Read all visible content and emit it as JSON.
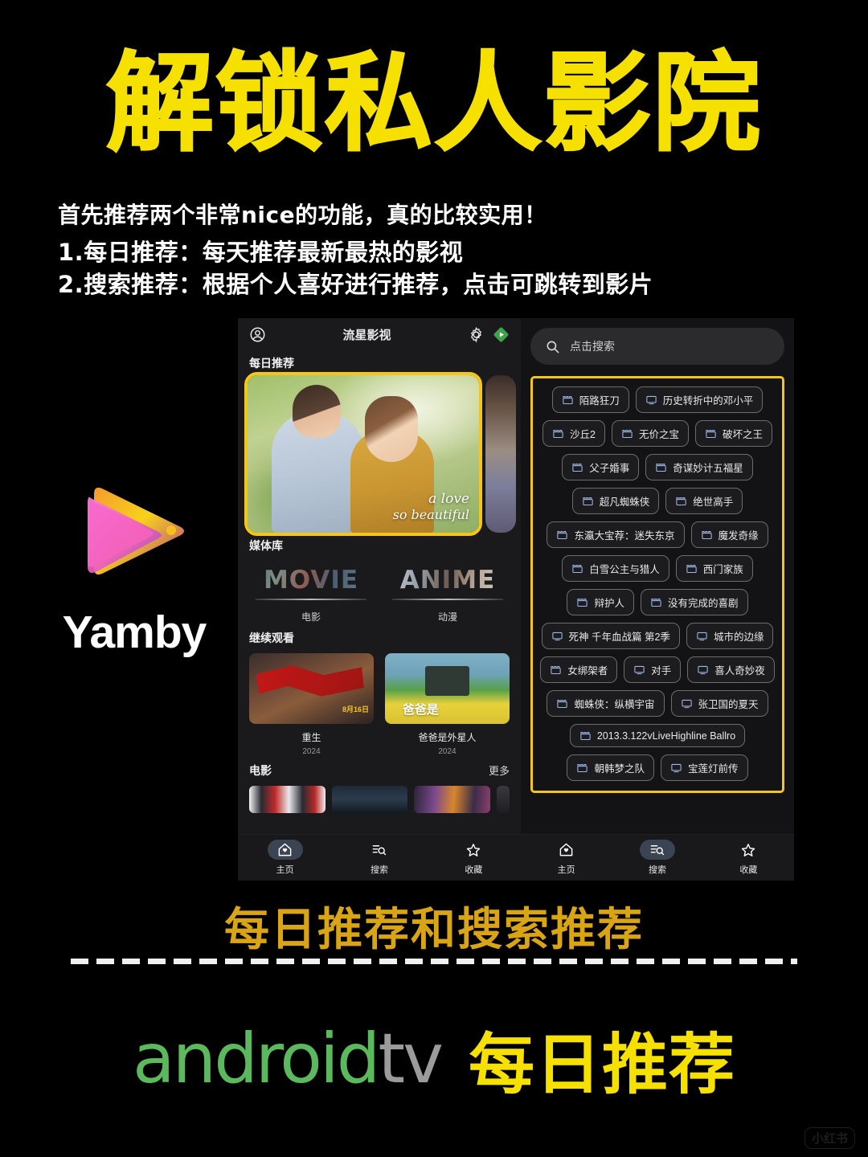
{
  "poster": {
    "headline": "解锁私人影院",
    "subtitle_lines": [
      "首先推荐两个非常nice的功能，真的比较实用！",
      "1.每日推荐：每天推荐最新最热的影视",
      "2.搜索推荐：根据个人喜好进行推荐，点击可跳转到影片"
    ],
    "caption": "每日推荐和搜索推荐",
    "watermark": "小红书",
    "accent_yellow": "#f5e000",
    "accent_gold": "#f5c518",
    "caption_gold": "#d9a514"
  },
  "brand": {
    "name": "Yamby",
    "logo_icon": "play-triangle-logo"
  },
  "footer": {
    "android_word": "android",
    "tv_word": "tv",
    "android_color": "#5cb85c",
    "tv_color": "#9b9b9b",
    "chinese": "每日推荐"
  },
  "app": {
    "title": "流星影视",
    "header_icons": [
      "account-circle-icon",
      "gear-icon",
      "green-diamond-play-icon"
    ],
    "home": {
      "daily_section_title": "每日推荐",
      "hero": {
        "caption_line1": "a love",
        "caption_line2": "so beautiful"
      },
      "library_section_title": "媒体库",
      "library": [
        {
          "art_text": "MOVIE",
          "label": "电影"
        },
        {
          "art_text": "ANIME",
          "label": "动漫"
        }
      ],
      "continue_section_title": "继续观看",
      "continue": [
        {
          "title": "重生",
          "year": "2024",
          "overlay_date": "8月16日"
        },
        {
          "title": "爸爸是外星人",
          "year": "2024",
          "overlay_text": "爸爸是"
        }
      ],
      "movies_section_title": "电影",
      "movies_more": "更多"
    },
    "search": {
      "placeholder": "点击搜索",
      "search_icon": "search-icon",
      "chip_rows": [
        [
          {
            "label": "陌路狂刀",
            "icon": "movie-clapper-icon"
          },
          {
            "label": "历史转折中的邓小平",
            "icon": "tv-monitor-icon"
          }
        ],
        [
          {
            "label": "沙丘2",
            "icon": "movie-clapper-icon"
          },
          {
            "label": "无价之宝",
            "icon": "movie-clapper-icon"
          },
          {
            "label": "破坏之王",
            "icon": "movie-clapper-icon"
          }
        ],
        [
          {
            "label": "父子婚事",
            "icon": "movie-clapper-icon"
          },
          {
            "label": "奇谋妙计五福星",
            "icon": "movie-clapper-icon"
          }
        ],
        [
          {
            "label": "超凡蜘蛛侠",
            "icon": "movie-clapper-icon"
          },
          {
            "label": "绝世高手",
            "icon": "movie-clapper-icon"
          }
        ],
        [
          {
            "label": "东瀛大宝荐：迷失东京",
            "icon": "movie-clapper-icon"
          },
          {
            "label": "魔发奇缘",
            "icon": "movie-clapper-icon"
          }
        ],
        [
          {
            "label": "白雪公主与猎人",
            "icon": "movie-clapper-icon"
          },
          {
            "label": "西门家族",
            "icon": "movie-clapper-icon"
          }
        ],
        [
          {
            "label": "辩护人",
            "icon": "movie-clapper-icon"
          },
          {
            "label": "没有完成的喜剧",
            "icon": "movie-clapper-icon"
          }
        ],
        [
          {
            "label": "死神 千年血战篇 第2季",
            "icon": "tv-monitor-icon"
          },
          {
            "label": "城市的边缘",
            "icon": "tv-monitor-icon"
          }
        ],
        [
          {
            "label": "女绑架者",
            "icon": "movie-clapper-icon"
          },
          {
            "label": "对手",
            "icon": "tv-monitor-icon"
          },
          {
            "label": "喜人奇妙夜",
            "icon": "tv-monitor-icon"
          }
        ],
        [
          {
            "label": "蜘蛛侠：纵横宇宙",
            "icon": "movie-clapper-icon"
          },
          {
            "label": "张卫国的夏天",
            "icon": "tv-monitor-icon"
          }
        ],
        [
          {
            "label": "2013.3.122vLiveHighline Ballro",
            "icon": "movie-clapper-icon"
          }
        ],
        [
          {
            "label": "朝韩梦之队",
            "icon": "movie-clapper-icon"
          },
          {
            "label": "宝莲灯前传",
            "icon": "tv-monitor-icon"
          }
        ]
      ]
    },
    "nav": {
      "items": [
        {
          "label": "主页",
          "icon": "home-icon"
        },
        {
          "label": "搜索",
          "icon": "search-list-icon"
        },
        {
          "label": "收藏",
          "icon": "star-icon"
        }
      ],
      "left_active_index": 0,
      "right_active_index": 1
    }
  }
}
